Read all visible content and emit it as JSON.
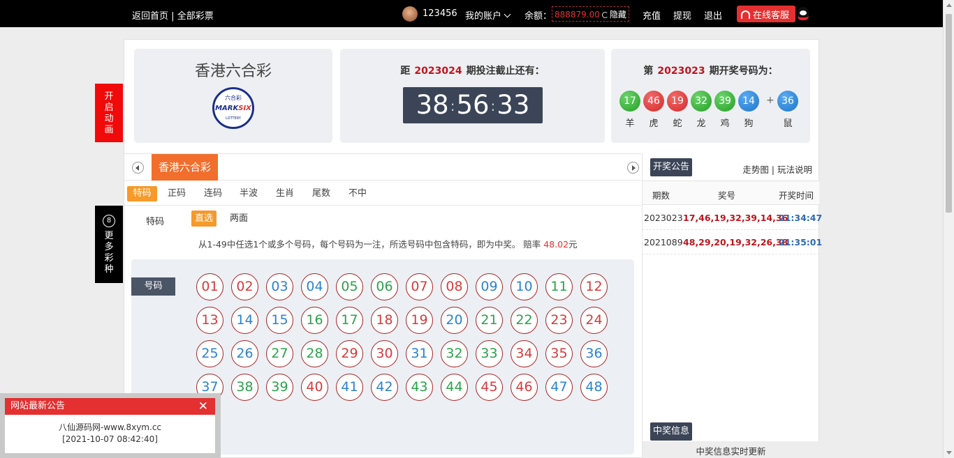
{
  "topbar": {
    "home": "返回首页",
    "sep": "|",
    "all_lottery": "全部彩票",
    "username": "123456",
    "account": "我的账户",
    "balance_label": "余额：",
    "balance": "888879.00",
    "hide": "隐藏",
    "recharge": "充值",
    "withdraw": "提现",
    "logout": "退出",
    "service": "在线客服"
  },
  "side": {
    "animation": [
      "开",
      "启",
      "动",
      "画"
    ],
    "more_icon": "8",
    "more": [
      "更",
      "多",
      "彩",
      "种"
    ]
  },
  "card1": {
    "name": "香港六合彩",
    "logo_top": "六合彩",
    "logo_main1": "MARK",
    "logo_main2": "SIX",
    "logo_bottom": "LOTTERY"
  },
  "card2": {
    "pre": "距",
    "issue": "2023024",
    "post": "期投注截止还有：",
    "h": "38",
    "m": "56",
    "s": "33",
    "sep": ":"
  },
  "card3": {
    "pre": "第",
    "issue": "2023023",
    "post": "期开奖号码为：",
    "balls": [
      {
        "n": "17",
        "z": "羊",
        "c": "g"
      },
      {
        "n": "46",
        "z": "虎",
        "c": "r"
      },
      {
        "n": "19",
        "z": "蛇",
        "c": "r"
      },
      {
        "n": "32",
        "z": "龙",
        "c": "g"
      },
      {
        "n": "39",
        "z": "鸡",
        "c": "g"
      },
      {
        "n": "14",
        "z": "狗",
        "c": "b"
      }
    ],
    "plus": "+",
    "special": {
      "n": "36",
      "z": "鼠",
      "c": "b"
    }
  },
  "game_tab": "香港六合彩",
  "tabs": [
    "特码",
    "正码",
    "连码",
    "半波",
    "生肖",
    "尾数",
    "不中"
  ],
  "subtitle": "特码",
  "options": [
    "直选",
    "两面"
  ],
  "desc": {
    "text": "从1-49中任选1个或多个号码，每个号码为一注，所选号码中包含特码，即为中奖。 赔率",
    "odds": "48.02",
    "unit": "元"
  },
  "num_label": "号码",
  "numbers": [
    {
      "n": "01",
      "c": "r"
    },
    {
      "n": "02",
      "c": "r"
    },
    {
      "n": "03",
      "c": "b"
    },
    {
      "n": "04",
      "c": "b"
    },
    {
      "n": "05",
      "c": "g"
    },
    {
      "n": "06",
      "c": "g"
    },
    {
      "n": "07",
      "c": "r"
    },
    {
      "n": "08",
      "c": "r"
    },
    {
      "n": "09",
      "c": "b"
    },
    {
      "n": "10",
      "c": "b"
    },
    {
      "n": "11",
      "c": "g"
    },
    {
      "n": "12",
      "c": "r"
    },
    {
      "n": "13",
      "c": "r"
    },
    {
      "n": "14",
      "c": "b"
    },
    {
      "n": "15",
      "c": "b"
    },
    {
      "n": "16",
      "c": "g"
    },
    {
      "n": "17",
      "c": "g"
    },
    {
      "n": "18",
      "c": "r"
    },
    {
      "n": "19",
      "c": "r"
    },
    {
      "n": "20",
      "c": "b"
    },
    {
      "n": "21",
      "c": "g"
    },
    {
      "n": "22",
      "c": "g"
    },
    {
      "n": "23",
      "c": "r"
    },
    {
      "n": "24",
      "c": "r"
    },
    {
      "n": "25",
      "c": "b"
    },
    {
      "n": "26",
      "c": "b"
    },
    {
      "n": "27",
      "c": "g"
    },
    {
      "n": "28",
      "c": "g"
    },
    {
      "n": "29",
      "c": "r"
    },
    {
      "n": "30",
      "c": "r"
    },
    {
      "n": "31",
      "c": "b"
    },
    {
      "n": "32",
      "c": "g"
    },
    {
      "n": "33",
      "c": "g"
    },
    {
      "n": "34",
      "c": "r"
    },
    {
      "n": "35",
      "c": "r"
    },
    {
      "n": "36",
      "c": "b"
    },
    {
      "n": "37",
      "c": "b"
    },
    {
      "n": "38",
      "c": "g"
    },
    {
      "n": "39",
      "c": "g"
    },
    {
      "n": "40",
      "c": "r"
    },
    {
      "n": "41",
      "c": "b"
    },
    {
      "n": "42",
      "c": "b"
    },
    {
      "n": "43",
      "c": "g"
    },
    {
      "n": "44",
      "c": "g"
    },
    {
      "n": "45",
      "c": "r"
    },
    {
      "n": "46",
      "c": "r"
    },
    {
      "n": "47",
      "c": "b"
    },
    {
      "n": "48",
      "c": "b"
    }
  ],
  "results": {
    "button": "开奖公告",
    "links": "走势图 | 玩法说明",
    "headers": [
      "期数",
      "奖号",
      "开奖时间"
    ],
    "rows": [
      {
        "issue": "2023023",
        "nums": "17,46,19,32,39,14,36",
        "time": "21:34:47"
      },
      {
        "issue": "2021089",
        "nums": "48,29,20,19,32,26,38",
        "time": "21:35:01"
      }
    ],
    "win_button": "中奖信息",
    "win_footer": "中奖信息实时更新"
  },
  "notice": {
    "title": "网站最新公告",
    "close": "✕",
    "line1": "八仙源码网-www.8xym.cc",
    "line2": "[2021-10-07 08:42:40]"
  }
}
